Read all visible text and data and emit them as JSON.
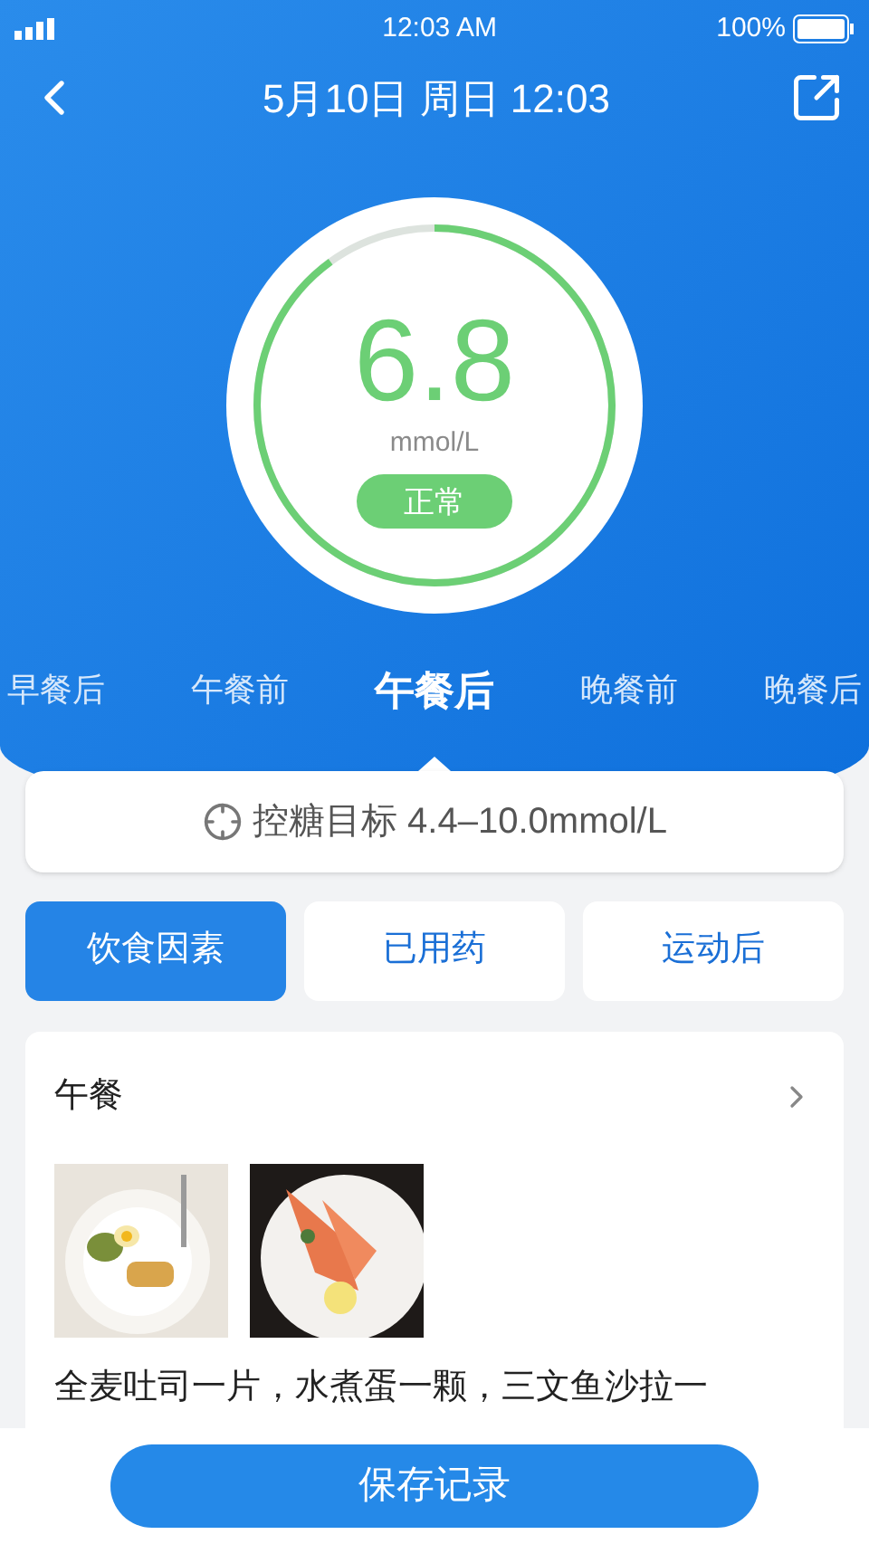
{
  "status_bar": {
    "time": "12:03 AM",
    "battery": "100%"
  },
  "header": {
    "title": "5月10日 周日 12:03"
  },
  "reading": {
    "value": "6.8",
    "unit": "mmol/L",
    "status": "正常"
  },
  "periods": [
    {
      "label": "早餐后",
      "selected": false
    },
    {
      "label": "午餐前",
      "selected": false
    },
    {
      "label": "午餐后",
      "selected": true
    },
    {
      "label": "晚餐前",
      "selected": false
    },
    {
      "label": "晚餐后",
      "selected": false
    }
  ],
  "target": {
    "text": "控糖目标 4.4–10.0mmol/L"
  },
  "factors": [
    {
      "label": "饮食因素",
      "selected": true
    },
    {
      "label": "已用药",
      "selected": false
    },
    {
      "label": "运动后",
      "selected": false
    }
  ],
  "meal": {
    "title": "午餐",
    "note": "全麦吐司一片，水煮蛋一颗，三文鱼沙拉一"
  },
  "save_button": "保存记录"
}
